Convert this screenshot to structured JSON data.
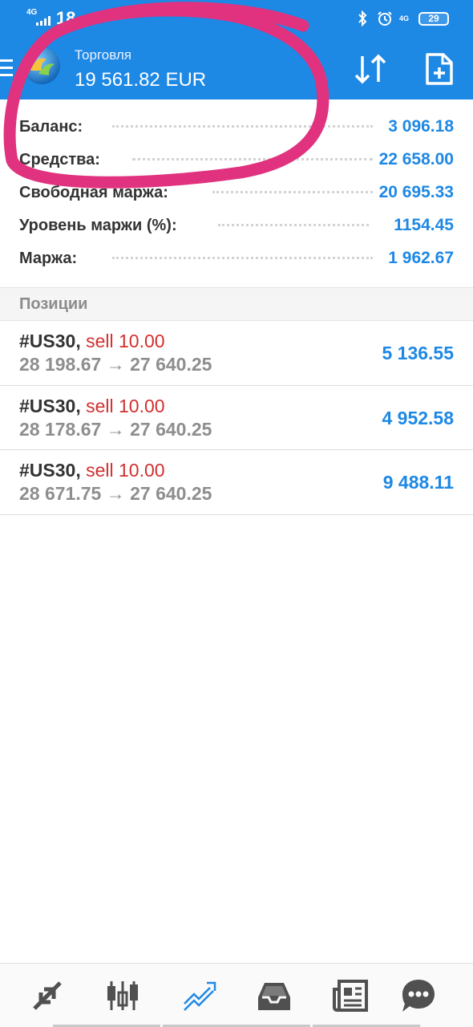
{
  "status_bar": {
    "network": "4G",
    "time": "18",
    "network_right": "4G",
    "battery": "29"
  },
  "header": {
    "menu_icon": "menu-icon",
    "logo_icon": "app-logo",
    "label": "Торговля",
    "balance": "19 561.82 EUR",
    "sort_icon": "sort-arrows-icon",
    "new_order_icon": "new-order-icon"
  },
  "summary": {
    "rows": [
      {
        "label": "Баланс:",
        "value": "3 096.18"
      },
      {
        "label": "Средства:",
        "value": "22 658.00"
      },
      {
        "label": "Свободная маржа:",
        "value": "20 695.33"
      },
      {
        "label": "Уровень маржи (%):",
        "value": "1154.45"
      },
      {
        "label": "Маржа:",
        "value": "1 962.67"
      }
    ]
  },
  "positions_section": {
    "title": "Позиции",
    "items": [
      {
        "symbol": "#US30,",
        "direction": "sell 10.00",
        "open_price": "28 198.67",
        "arrow": "→",
        "current_price": "27 640.25",
        "profit": "5 136.55"
      },
      {
        "symbol": "#US30,",
        "direction": "sell 10.00",
        "open_price": "28 178.67",
        "arrow": "→",
        "current_price": "27 640.25",
        "profit": "4 952.58"
      },
      {
        "symbol": "#US30,",
        "direction": "sell 10.00",
        "open_price": "28 671.75",
        "arrow": "→",
        "current_price": "27 640.25",
        "profit": "9 488.11"
      }
    ]
  },
  "bottom_nav": {
    "items": [
      {
        "icon": "quotes-icon"
      },
      {
        "icon": "chart-icon"
      },
      {
        "icon": "trade-icon",
        "active": true
      },
      {
        "icon": "history-icon"
      },
      {
        "icon": "news-icon"
      },
      {
        "icon": "messages-icon"
      }
    ]
  },
  "colors": {
    "header": "#1e88e5",
    "value": "#1e88e5",
    "sell": "#d32f2f",
    "annotation": "#e0327e"
  }
}
